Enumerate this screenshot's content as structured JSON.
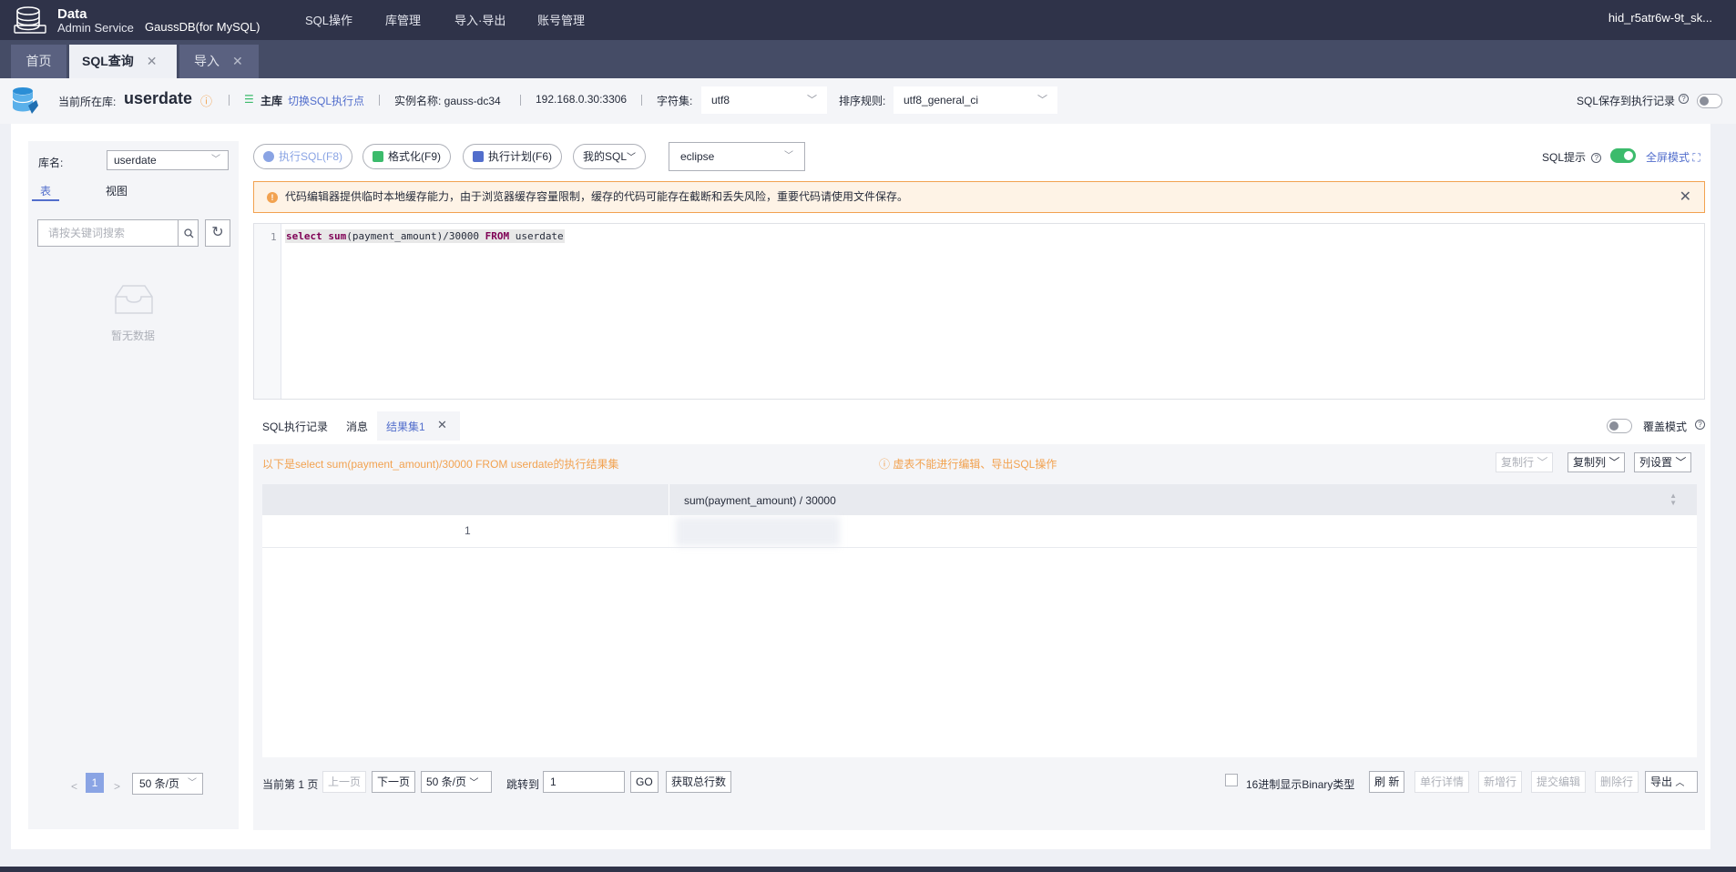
{
  "topbar": {
    "logo_line1": "Data",
    "logo_line2": "Admin Service",
    "product": "GaussDB(for MySQL)",
    "nav": [
      "SQL操作",
      "库管理",
      "导入·导出",
      "账号管理"
    ],
    "user": "hid_r5atr6w-9t_sk..."
  },
  "tabs": [
    {
      "label": "首页"
    },
    {
      "label": "SQL查询",
      "close": "✕"
    },
    {
      "label": "导入",
      "close": "✕"
    }
  ],
  "infobar": {
    "current_db_label": "当前所在库:",
    "current_db": "userdate",
    "master_label": "主库",
    "switch_node": "切换SQL执行点",
    "instance": "实例名称: gauss-dc34",
    "address": "192.168.0.30:3306",
    "charset_label": "字符集:",
    "charset_value": "utf8",
    "collation_label": "排序规则:",
    "collation_value": "utf8_general_ci",
    "save_sql_label": "SQL保存到执行记录"
  },
  "left": {
    "db_label": "库名:",
    "db_value": "userdate",
    "tab_table": "表",
    "tab_view": "视图",
    "search_placeholder": "请按关键词搜索",
    "empty_text": "暂无数据",
    "page": "1",
    "page_size": "50 条/页"
  },
  "toolbar": {
    "run": "执行SQL(F8)",
    "format": "格式化(F9)",
    "plan": "执行计划(F6)",
    "my_sql": "我的SQL",
    "theme": "eclipse",
    "sql_hint": "SQL提示",
    "fullscreen": "全屏模式"
  },
  "alert": {
    "text": "代码编辑器提供临时本地缓存能力，由于浏览器缓存容量限制，缓存的代码可能存在截断和丢失风险，重要代码请使用文件保存。"
  },
  "editor": {
    "line_number": "1",
    "kw_select": "select",
    "kw_sum": "sum",
    "expr": "(payment_amount)/30000 ",
    "kw_from": "FROM",
    "table": " userdate"
  },
  "result_tabs": {
    "history": "SQL执行记录",
    "messages": "消息",
    "resultset": "结果集1",
    "overwrite": "覆盖模式"
  },
  "result": {
    "info": "以下是select sum(payment_amount)/30000 FROM userdate的执行结果集",
    "warning": "ⓘ 虚表不能进行编辑、导出SQL操作",
    "copy_row": "复制行",
    "copy_col": "复制列",
    "col_settings": "列设置",
    "column_title": "sum(payment_amount) / 30000",
    "row_number": "1"
  },
  "pager": {
    "current_page": "当前第 1 页",
    "prev": "上一页",
    "next": "下一页",
    "page_size": "50 条/页",
    "jump_label": "跳转到",
    "jump_value": "1",
    "go": "GO",
    "total_rows": "获取总行数",
    "hex_binary": "16进制显示Binary类型",
    "refresh": "刷 新",
    "row_detail": "单行详情",
    "add_row": "新增行",
    "submit_edit": "提交编辑",
    "delete_row": "删除行",
    "export": "导出"
  }
}
